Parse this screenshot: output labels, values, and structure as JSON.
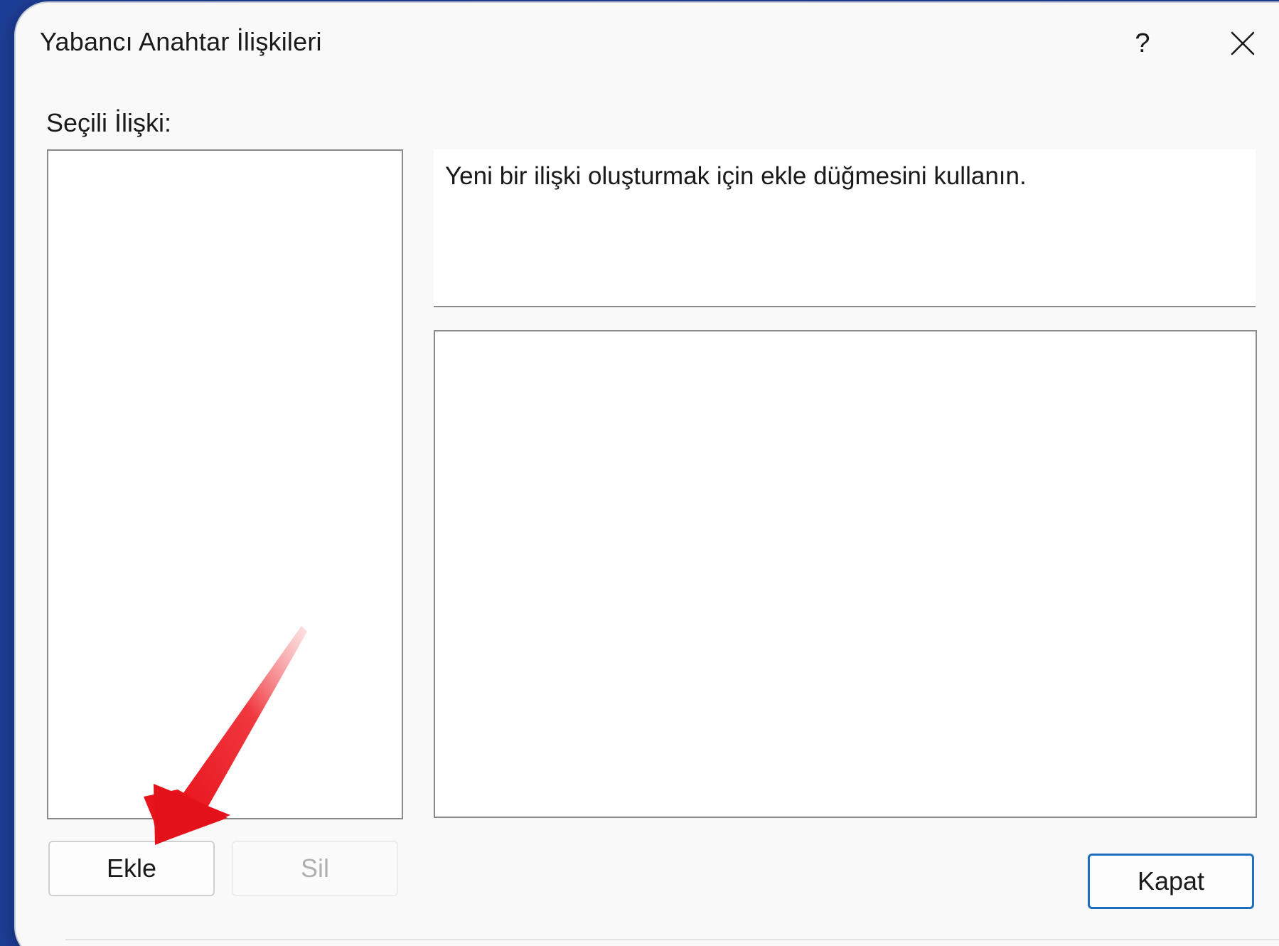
{
  "dialog": {
    "title": "Yabancı Anahtar İlişkileri",
    "help_label": "?",
    "close_icon": "close-icon"
  },
  "selected_relation": {
    "label": "Seçili İlişki:",
    "items": []
  },
  "description": {
    "text": "Yeni bir ilişki oluşturmak için ekle düğmesini kullanın."
  },
  "buttons": {
    "add_label": "Ekle",
    "delete_label": "Sil",
    "close_label": "Kapat"
  },
  "colors": {
    "background": "#1c3d94",
    "dialog": "#f9f9f9",
    "accent_border": "#1f6fc0",
    "annotation_arrow": "#e8141c",
    "disabled_text": "#b0b0b0"
  },
  "annotation": {
    "icon": "red-arrow-pointer",
    "target": "add-button"
  }
}
